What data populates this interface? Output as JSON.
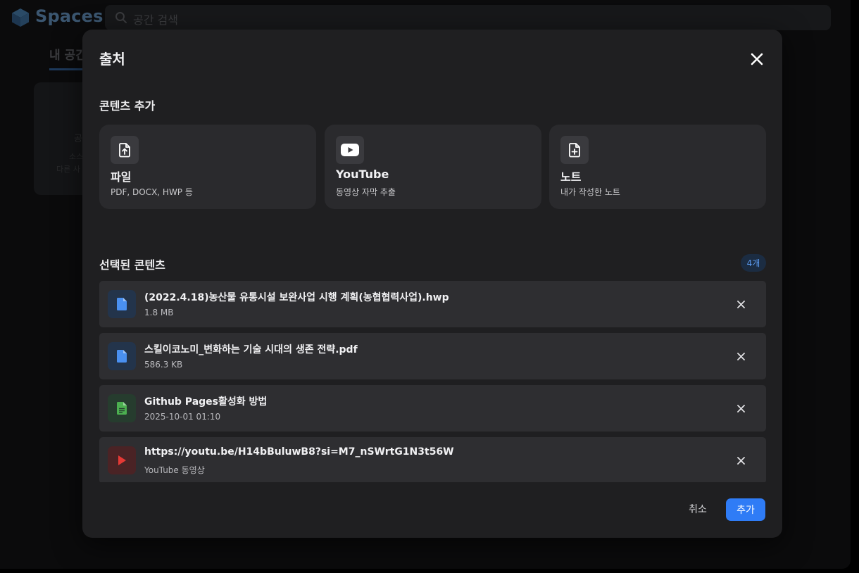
{
  "background": {
    "app_title": "Spaces",
    "search_placeholder": "공간 검색",
    "tab_label": "내 공간",
    "card_title": "공",
    "card_line1": "소스",
    "card_line2": "다른 사"
  },
  "modal": {
    "title": "출처",
    "add_section_title": "콘텐츠 추가",
    "options": [
      {
        "title": "파일",
        "desc": "PDF, DOCX, HWP 등",
        "icon": "file-upload-icon"
      },
      {
        "title": "YouTube",
        "desc": "동영상 자막 추출",
        "icon": "youtube-icon"
      },
      {
        "title": "노트",
        "desc": "내가 작성한 노트",
        "icon": "note-add-icon"
      }
    ],
    "selected_section_title": "선택된 콘텐츠",
    "selected_count": "4개",
    "items": [
      {
        "name": "(2022.4.18)농산물 유통시설 보완사업 시행 계획(농협협력사업).hwp",
        "meta": "1.8 MB",
        "icon": "document-icon",
        "color": "#4a90f0"
      },
      {
        "name": "스킬이코노미_변화하는 기술 시대의 생존 전략.pdf",
        "meta": "586.3 KB",
        "icon": "document-icon",
        "color": "#4a90f0"
      },
      {
        "name": "Github Pages활성화 방법",
        "meta": "2025-10-01 01:10",
        "icon": "note-icon",
        "color": "#4caf50"
      },
      {
        "name": "https://youtu.be/H14bBuluwB8?si=M7_nSWrtG1N3t56W",
        "meta": "YouTube 동영상",
        "icon": "play-icon",
        "color": "#e53935"
      }
    ],
    "cancel_label": "취소",
    "add_label": "추가"
  },
  "colors": {
    "accent": "#2f7cf6",
    "modal_bg": "#1f1f21",
    "card_bg": "#2a2a2d"
  }
}
